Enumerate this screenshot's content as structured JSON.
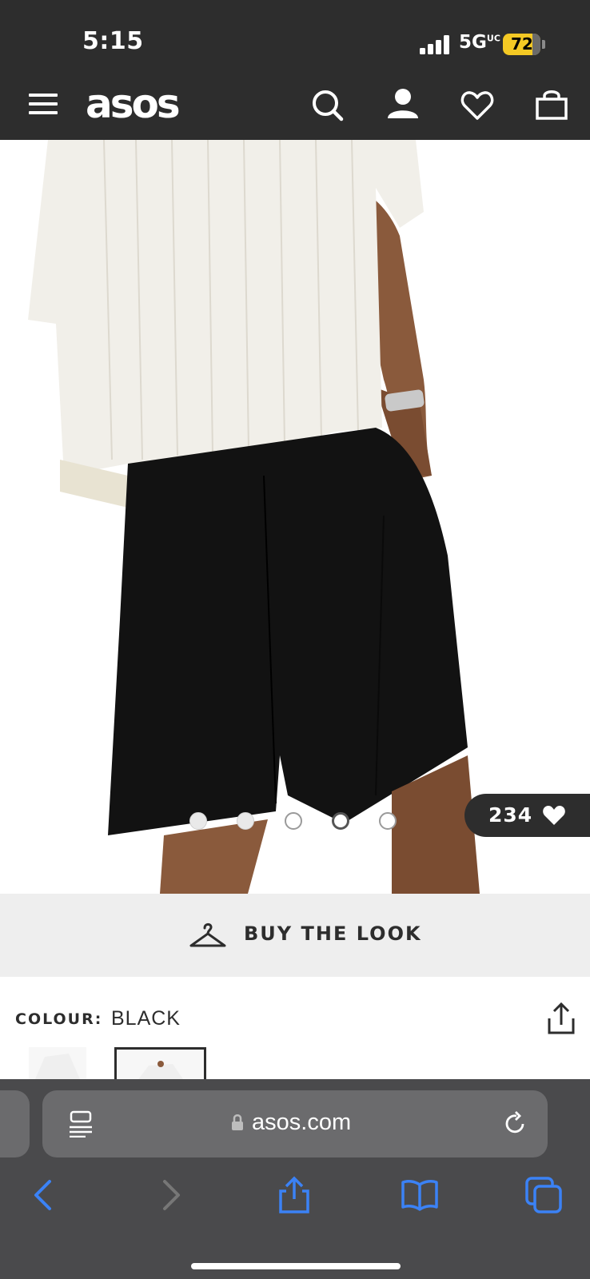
{
  "status_bar": {
    "time": "5:15",
    "network": "5G",
    "network_suffix": "UC",
    "battery": "72",
    "battery_color": "#f4c924"
  },
  "header": {
    "logo": "asos",
    "icons": [
      "menu-icon",
      "search-icon",
      "account-icon",
      "heart-icon",
      "bag-icon"
    ],
    "background": "#2d2d2d"
  },
  "gallery": {
    "image_count": 5,
    "active_index": 3,
    "saves_count": "234",
    "saves_icon": "heart-icon"
  },
  "buy_the_look": {
    "label": "BUY THE LOOK",
    "icon": "hanger-icon"
  },
  "product": {
    "colour_label": "COLOUR:",
    "colour_value": "BLACK",
    "share_icon": "share-icon"
  },
  "browser": {
    "url": "asos.com",
    "toolbar": [
      "back-icon",
      "forward-icon",
      "share-icon",
      "bookmarks-icon",
      "tabs-icon"
    ],
    "accent": "#3b82f6"
  }
}
